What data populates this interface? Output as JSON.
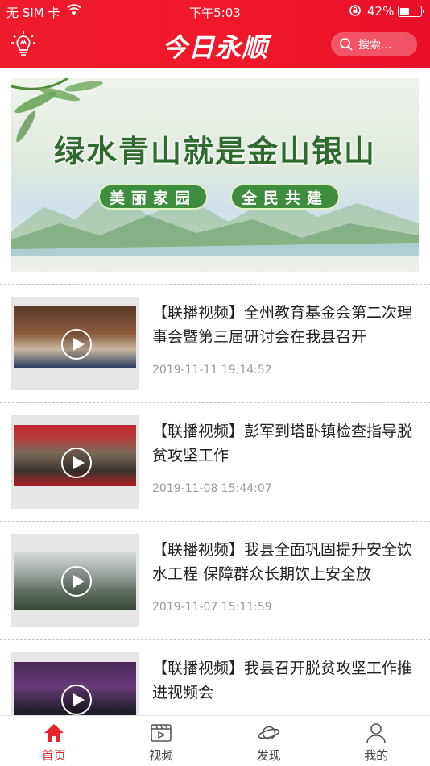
{
  "status_bar": {
    "carrier": "无 SIM 卡",
    "time": "下午5:03",
    "battery": "42%",
    "battery_level": 0.42
  },
  "header": {
    "logo_text": "今日永顺",
    "search_placeholder": "搜索...",
    "bulb_icon": "lightbulb-icon",
    "brand_color": "#ee1b2c"
  },
  "banner": {
    "title": "绿水青山就是金山银山",
    "pill_left": "美丽家园",
    "pill_right": "全民共建"
  },
  "news": [
    {
      "title": "【联播视频】全州教育基金会第二次理事会暨第三届研讨会在我县召开",
      "date": "2019-11-11 19:14:52"
    },
    {
      "title": "【联播视频】彭军到塔卧镇检查指导脱贫攻坚工作",
      "date": "2019-11-08 15:44:07"
    },
    {
      "title": "【联播视频】我县全面巩固提升安全饮水工程 保障群众长期饮上安全放",
      "date": "2019-11-07 15:11:59"
    },
    {
      "title": "【联播视频】我县召开脱贫攻坚工作推进视频会",
      "date": ""
    }
  ],
  "tabbar": {
    "home": "首页",
    "video": "视频",
    "discover": "发现",
    "mine": "我的",
    "active_color": "#e8232e"
  }
}
